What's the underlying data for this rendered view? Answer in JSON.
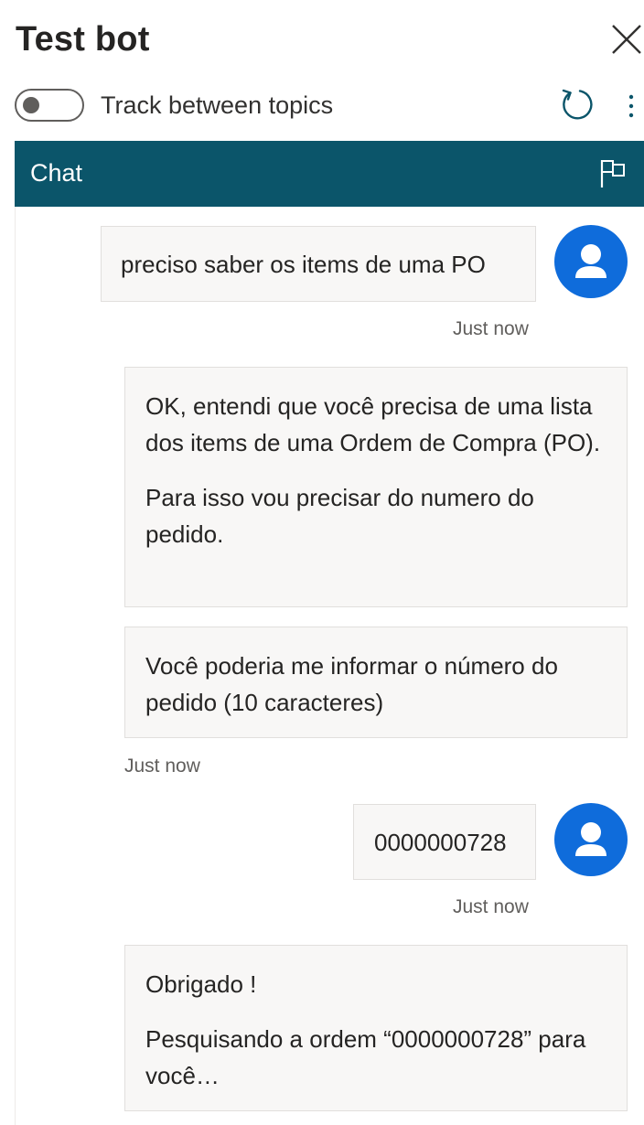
{
  "header": {
    "title": "Test bot",
    "close_icon": "close-icon"
  },
  "toolbar": {
    "track_toggle_label": "Track between topics",
    "track_toggle_on": false,
    "refresh_icon": "refresh-icon",
    "more_icon": "more-vertical-icon"
  },
  "chat": {
    "tab_title": "Chat",
    "flag_icon": "flag-icon",
    "header_color": "#0b556a",
    "avatar_color": "#0f6cdb",
    "messages": [
      {
        "from": "user",
        "text": "preciso saber os items de uma PO",
        "time": "Just now"
      },
      {
        "from": "bot",
        "paragraphs": [
          "OK, entendi que você precisa de uma lista dos items de uma Ordem de Compra (PO).",
          "Para isso vou precisar do numero do pedido."
        ]
      },
      {
        "from": "bot",
        "paragraphs": [
          "Você poderia me informar o número do pedido (10 caracteres)"
        ],
        "time": "Just now"
      },
      {
        "from": "user",
        "text": "0000000728",
        "time": "Just now"
      },
      {
        "from": "bot",
        "paragraphs": [
          "Obrigado !",
          "Pesquisando a ordem “0000000728” para você…"
        ]
      }
    ]
  }
}
